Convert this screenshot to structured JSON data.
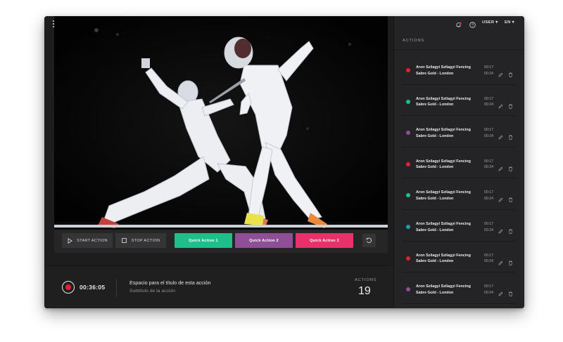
{
  "topbar": {
    "user_label": "USER",
    "lang_label": "EN"
  },
  "player": {
    "progress": 1.0
  },
  "controls": {
    "start_label": "START ACTION",
    "stop_label": "STOP ACTION",
    "quick_actions": [
      {
        "label": "Quick Action 1",
        "color": "#1fbf8c"
      },
      {
        "label": "Quick Action 2",
        "color": "#8e4f97"
      },
      {
        "label": "Quick Action 3",
        "color": "#e8306a"
      }
    ]
  },
  "recording": {
    "timer": "00:36:05",
    "title": "Espacio para el título de esta acción",
    "subtitle": "Subtítulo de la acción",
    "actions_label": "ACTIONS",
    "actions_count": "19"
  },
  "sidebar": {
    "heading": "ACTIONS",
    "items": [
      {
        "line1": "Aron Szilagyi Szilagyi Fencing",
        "line2": "Sabre Gold - London",
        "time_start": "00:17",
        "time_end": "00:24",
        "color": "#e5212f"
      },
      {
        "line1": "Aron Szilagyi Szilagyi Fencing",
        "line2": "Sabre Gold - London",
        "time_start": "00:17",
        "time_end": "00:24",
        "color": "#1fbf8c"
      },
      {
        "line1": "Aron Szilagyi Szilagyi Fencing",
        "line2": "Sabre Gold - London",
        "time_start": "00:17",
        "time_end": "00:24",
        "color": "#8e4f97"
      },
      {
        "line1": "Aron Szilagyi Szilagyi Fencing",
        "line2": "Sabre Gold - London",
        "time_start": "00:17",
        "time_end": "00:24",
        "color": "#e5212f"
      },
      {
        "line1": "Aron Szilagyi Szilagyi Fencing",
        "line2": "Sabre Gold - London",
        "time_start": "00:17",
        "time_end": "00:24",
        "color": "#1fbf8c"
      },
      {
        "line1": "Aron Szilagyi Szilagyi Fencing",
        "line2": "Sabre Gold - London",
        "time_start": "00:17",
        "time_end": "00:24",
        "color": "#1a9fb5"
      },
      {
        "line1": "Aron Szilagyi Szilagyi Fencing",
        "line2": "Sabre Gold - London",
        "time_start": "00:17",
        "time_end": "00:24",
        "color": "#e5212f"
      },
      {
        "line1": "Aron Szilagyi Szilagyi Fencing",
        "line2": "Sabre Gold - London",
        "time_start": "00:17",
        "time_end": "00:24",
        "color": "#8e4f97"
      }
    ]
  }
}
